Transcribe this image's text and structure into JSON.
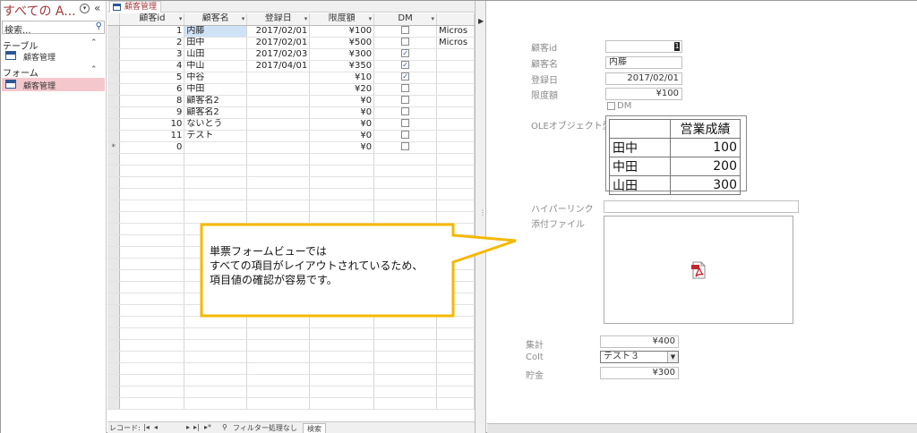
{
  "nav": {
    "title": "すべての A...",
    "search_placeholder": "検索...",
    "groups": [
      {
        "label": "テーブル",
        "items": [
          {
            "label": "顧客管理"
          }
        ]
      },
      {
        "label": "フォーム",
        "items": [
          {
            "label": "顧客管理"
          }
        ]
      }
    ]
  },
  "datasheet": {
    "tab_label": "顧客管理",
    "columns": [
      "顧客id",
      "顧客名",
      "登録日",
      "限度額",
      "DM"
    ],
    "rows": [
      {
        "id": "1",
        "name": "内藤",
        "date": "2017/02/01",
        "limit": "¥100",
        "dm": false,
        "extra": "Micros"
      },
      {
        "id": "2",
        "name": "田中",
        "date": "2017/02/01",
        "limit": "¥500",
        "dm": false,
        "extra": "Micros"
      },
      {
        "id": "3",
        "name": "山田",
        "date": "2017/02/03",
        "limit": "¥300",
        "dm": true,
        "extra": ""
      },
      {
        "id": "4",
        "name": "中山",
        "date": "2017/04/01",
        "limit": "¥350",
        "dm": true,
        "extra": ""
      },
      {
        "id": "5",
        "name": "中谷",
        "date": "",
        "limit": "¥10",
        "dm": true,
        "extra": ""
      },
      {
        "id": "6",
        "name": "中田",
        "date": "",
        "limit": "¥20",
        "dm": false,
        "extra": ""
      },
      {
        "id": "8",
        "name": "顧客名2",
        "date": "",
        "limit": "¥0",
        "dm": false,
        "extra": ""
      },
      {
        "id": "9",
        "name": "顧客名2",
        "date": "",
        "limit": "¥0",
        "dm": false,
        "extra": ""
      },
      {
        "id": "10",
        "name": "ないとう",
        "date": "",
        "limit": "¥0",
        "dm": false,
        "extra": ""
      },
      {
        "id": "11",
        "name": "テスト",
        "date": "",
        "limit": "¥0",
        "dm": false,
        "extra": ""
      }
    ],
    "new_row": {
      "marker": "*",
      "id": "0",
      "limit": "¥0"
    }
  },
  "record_bar": {
    "label": "レコード:",
    "filter_label": "フィルター処理なし",
    "search_label": "検索"
  },
  "form": {
    "fields": {
      "id": {
        "label": "顧客id",
        "value": "1"
      },
      "name": {
        "label": "顧客名",
        "value": "内藤"
      },
      "date": {
        "label": "登録日",
        "value": "2017/02/01"
      },
      "limit": {
        "label": "限度額",
        "value": "¥100"
      },
      "dm": {
        "label": "DM",
        "checked": false
      },
      "ole": {
        "label": "OLEオブジェクト型"
      },
      "hyperlink": {
        "label": "ハイパーリンク",
        "value": ""
      },
      "attachment": {
        "label": "添付ファイル"
      },
      "total": {
        "label": "集計",
        "value": "¥400"
      },
      "colt": {
        "label": "Colt",
        "value": "テスト３"
      },
      "savings": {
        "label": "貯金",
        "value": "¥300"
      }
    },
    "ole_table": {
      "header": [
        "",
        "営業成績"
      ],
      "rows": [
        [
          "田中",
          "100"
        ],
        [
          "中田",
          "200"
        ],
        [
          "山田",
          "300"
        ]
      ]
    }
  },
  "callout": {
    "lines": [
      "単票フォームビューでは",
      "すべての項目がレイアウトされているため、",
      "項目値の確認が容易です。"
    ],
    "border_color": "#f5b800"
  },
  "colors": {
    "nav_title": "#a4373a",
    "nav_selected": "#f4c7cc",
    "selected_cell": "#cfe3f7",
    "icon_blue": "#2b5797"
  }
}
